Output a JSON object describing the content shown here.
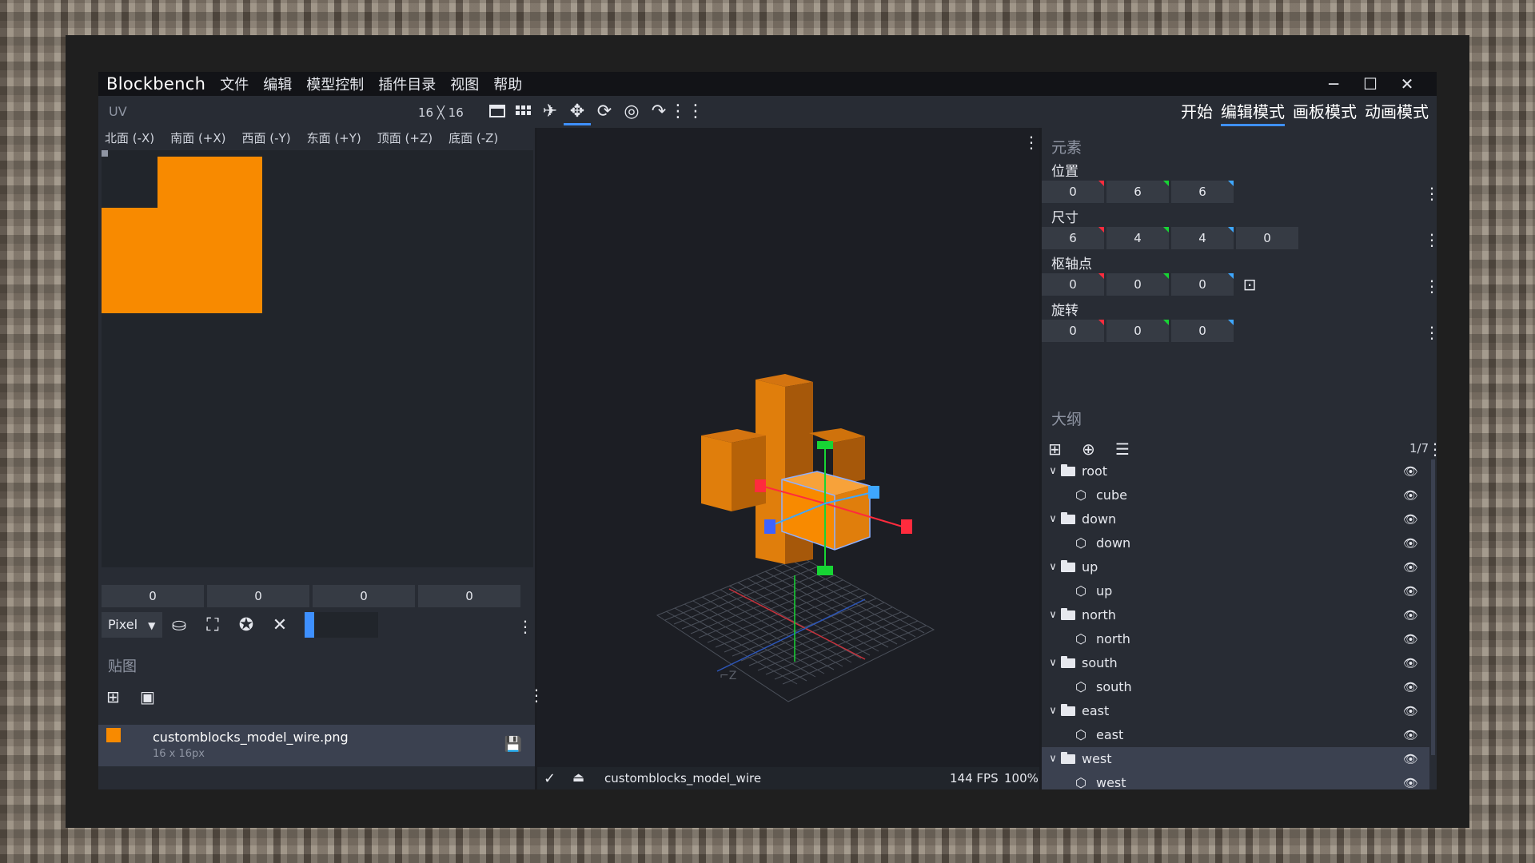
{
  "app": {
    "name": "Blockbench"
  },
  "menu": [
    "文件",
    "编辑",
    "模型控制",
    "插件目录",
    "视图",
    "帮助"
  ],
  "window_controls": {
    "minimize": "─",
    "maximize": "☐",
    "close": "✕"
  },
  "uv": {
    "title": "UV",
    "size": "16 ╳ 16",
    "faces": [
      {
        "label": "北面 (-X)"
      },
      {
        "label": "南面 (+X)"
      },
      {
        "label": "西面 (-Y)",
        "selected": true
      },
      {
        "label": "东面 (+Y)"
      },
      {
        "label": "顶面 (+Z)"
      },
      {
        "label": "底面 (-Z)"
      }
    ],
    "coords": [
      "0",
      "0",
      "0",
      "0"
    ],
    "mode": "Pixel",
    "texture_color": "#f88a00"
  },
  "textures": {
    "title": "贴图",
    "items": [
      {
        "name": "customblocks_model_wire.png",
        "size": "16 x 16px"
      }
    ]
  },
  "modes": [
    {
      "label": "开始"
    },
    {
      "label": "编辑模式",
      "selected": true
    },
    {
      "label": "画板模式"
    },
    {
      "label": "动画模式"
    }
  ],
  "status": {
    "model_name": "customblocks_model_wire",
    "fps": "144 FPS",
    "zoom": "100%"
  },
  "element": {
    "title": "元素",
    "position": {
      "label": "位置",
      "values": [
        "0",
        "6",
        "6"
      ]
    },
    "size": {
      "label": "尺寸",
      "values": [
        "6",
        "4",
        "4",
        "0"
      ]
    },
    "pivot": {
      "label": "枢轴点",
      "values": [
        "0",
        "0",
        "0"
      ]
    },
    "rotation": {
      "label": "旋转",
      "values": [
        "0",
        "0",
        "0"
      ]
    }
  },
  "outliner": {
    "title": "大纲",
    "count": "1/7",
    "groups": [
      {
        "name": "root",
        "child": "cube"
      },
      {
        "name": "down",
        "child": "down"
      },
      {
        "name": "up",
        "child": "up"
      },
      {
        "name": "north",
        "child": "north"
      },
      {
        "name": "south",
        "child": "south"
      },
      {
        "name": "east",
        "child": "east"
      },
      {
        "name": "west",
        "child": "west",
        "selected": true
      }
    ]
  },
  "colors": {
    "accent": "#3e90ff",
    "x_axis": "#ff2b3d",
    "y_axis": "#17d534",
    "z_axis": "#3ea7ff",
    "model": "#f88a00"
  }
}
